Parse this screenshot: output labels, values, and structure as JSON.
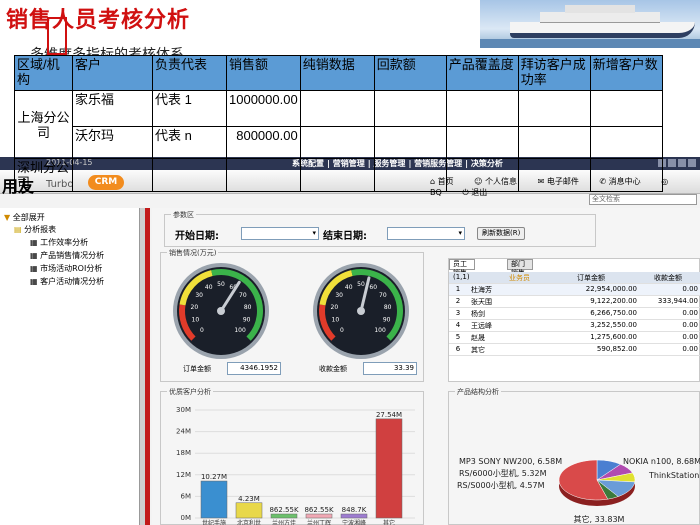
{
  "slide": {
    "title": "销售人员考核分析",
    "subtitle": "多维度多指标的考核体系"
  },
  "kpi_table": {
    "headers": [
      "区域/机构",
      "客户",
      "负责代表",
      "销售额",
      "纯销数据",
      "回款额",
      "产品覆盖度",
      "拜访客户成功率",
      "新增客户数"
    ],
    "rows": [
      [
        "上海分公司",
        "家乐福",
        "代表 1",
        "1000000.00",
        "",
        "",
        "",
        "",
        ""
      ],
      [
        "",
        "沃尔玛",
        "代表 n",
        "800000.00",
        "",
        "",
        "",
        "",
        ""
      ],
      [
        "深圳分公司",
        "",
        "",
        "",
        "",
        "",
        "",
        "",
        ""
      ]
    ]
  },
  "app": {
    "date": "2011-04-15",
    "menus": [
      "系统配置",
      "营销管理",
      "服务管理",
      "营销服务管理",
      "决策分析"
    ],
    "logo_cn": "用友",
    "logo_en": "Turbo",
    "logo_crm": "CRM",
    "topnav": [
      "首页",
      "个人信息",
      "电子邮件",
      "消息中心",
      "BQ",
      "退出"
    ],
    "search_placeholder": "全文检索"
  },
  "tree": {
    "expand_all": "全部展开",
    "root": "分析报表",
    "items": [
      "工作效率分析",
      "产品销售情况分析",
      "市场活动ROI分析",
      "客户活动情况分析"
    ]
  },
  "params": {
    "group_label": "参数区",
    "start_label": "开始日期:",
    "end_label": "结束日期:",
    "refresh_button": "刷新数据(R)"
  },
  "gauges": {
    "group_label": "销售情况(万元)",
    "order_label": "订单金额",
    "order_value": "4346.1952",
    "order_level": 62,
    "collect_label": "收款金额",
    "collect_value": "33.39",
    "collect_level": 55,
    "ticks": [
      "0",
      "10",
      "20",
      "30",
      "40",
      "50",
      "60",
      "70",
      "80",
      "90",
      "100"
    ]
  },
  "ranking": {
    "tabs": [
      "员工销售TOP5",
      "部门销售TOP5"
    ],
    "header": [
      "(1,1)",
      "业务员",
      "订单金额",
      "收款金额"
    ],
    "rows": [
      [
        "1",
        "杜海芳",
        "22,954,000.00",
        "0.00"
      ],
      [
        "2",
        "张天围",
        "9,122,200.00",
        "333,944.00"
      ],
      [
        "3",
        "杨剑",
        "6,266,750.00",
        "0.00"
      ],
      [
        "4",
        "王远峰",
        "3,252,550.00",
        "0.00"
      ],
      [
        "5",
        "赵晟",
        "1,275,600.00",
        "0.00"
      ],
      [
        "6",
        "其它",
        "590,852.00",
        "0.00"
      ]
    ]
  },
  "chart_data": [
    {
      "type": "bar",
      "title": "优质客户分析",
      "categories": [
        "世纪手施",
        "北京利世",
        "兰州方佳",
        "兰州丁辉",
        "宁波湘峰",
        "其它"
      ],
      "values": [
        10.27,
        4.23,
        0.86255,
        0.86255,
        0.8487,
        27.54
      ],
      "data_labels": [
        "10.27M",
        "4.23M",
        "862.55K",
        "862.55K",
        "848.7K",
        "27.54M"
      ],
      "ytick_labels": [
        "0M",
        "6M",
        "12M",
        "18M",
        "24M",
        "30M"
      ],
      "ylim": [
        0,
        30
      ]
    },
    {
      "type": "pie",
      "title": "产品结构分析",
      "labels": [
        "MP3 SONY NW200, 6.58M",
        "RS/6000小型机, 5.32M",
        "RS/S000小型机, 4.57M",
        "NOKIA n100, 8.68M",
        "ThinkStation",
        "其它, 33.83M"
      ],
      "values": [
        6.58,
        5.32,
        4.57,
        8.68,
        3.0,
        33.83
      ],
      "colors": [
        "#4a7fd1",
        "#b04ab0",
        "#e0e030",
        "#6a9cd8",
        "#3b7a3b",
        "#d94a4a"
      ]
    }
  ]
}
